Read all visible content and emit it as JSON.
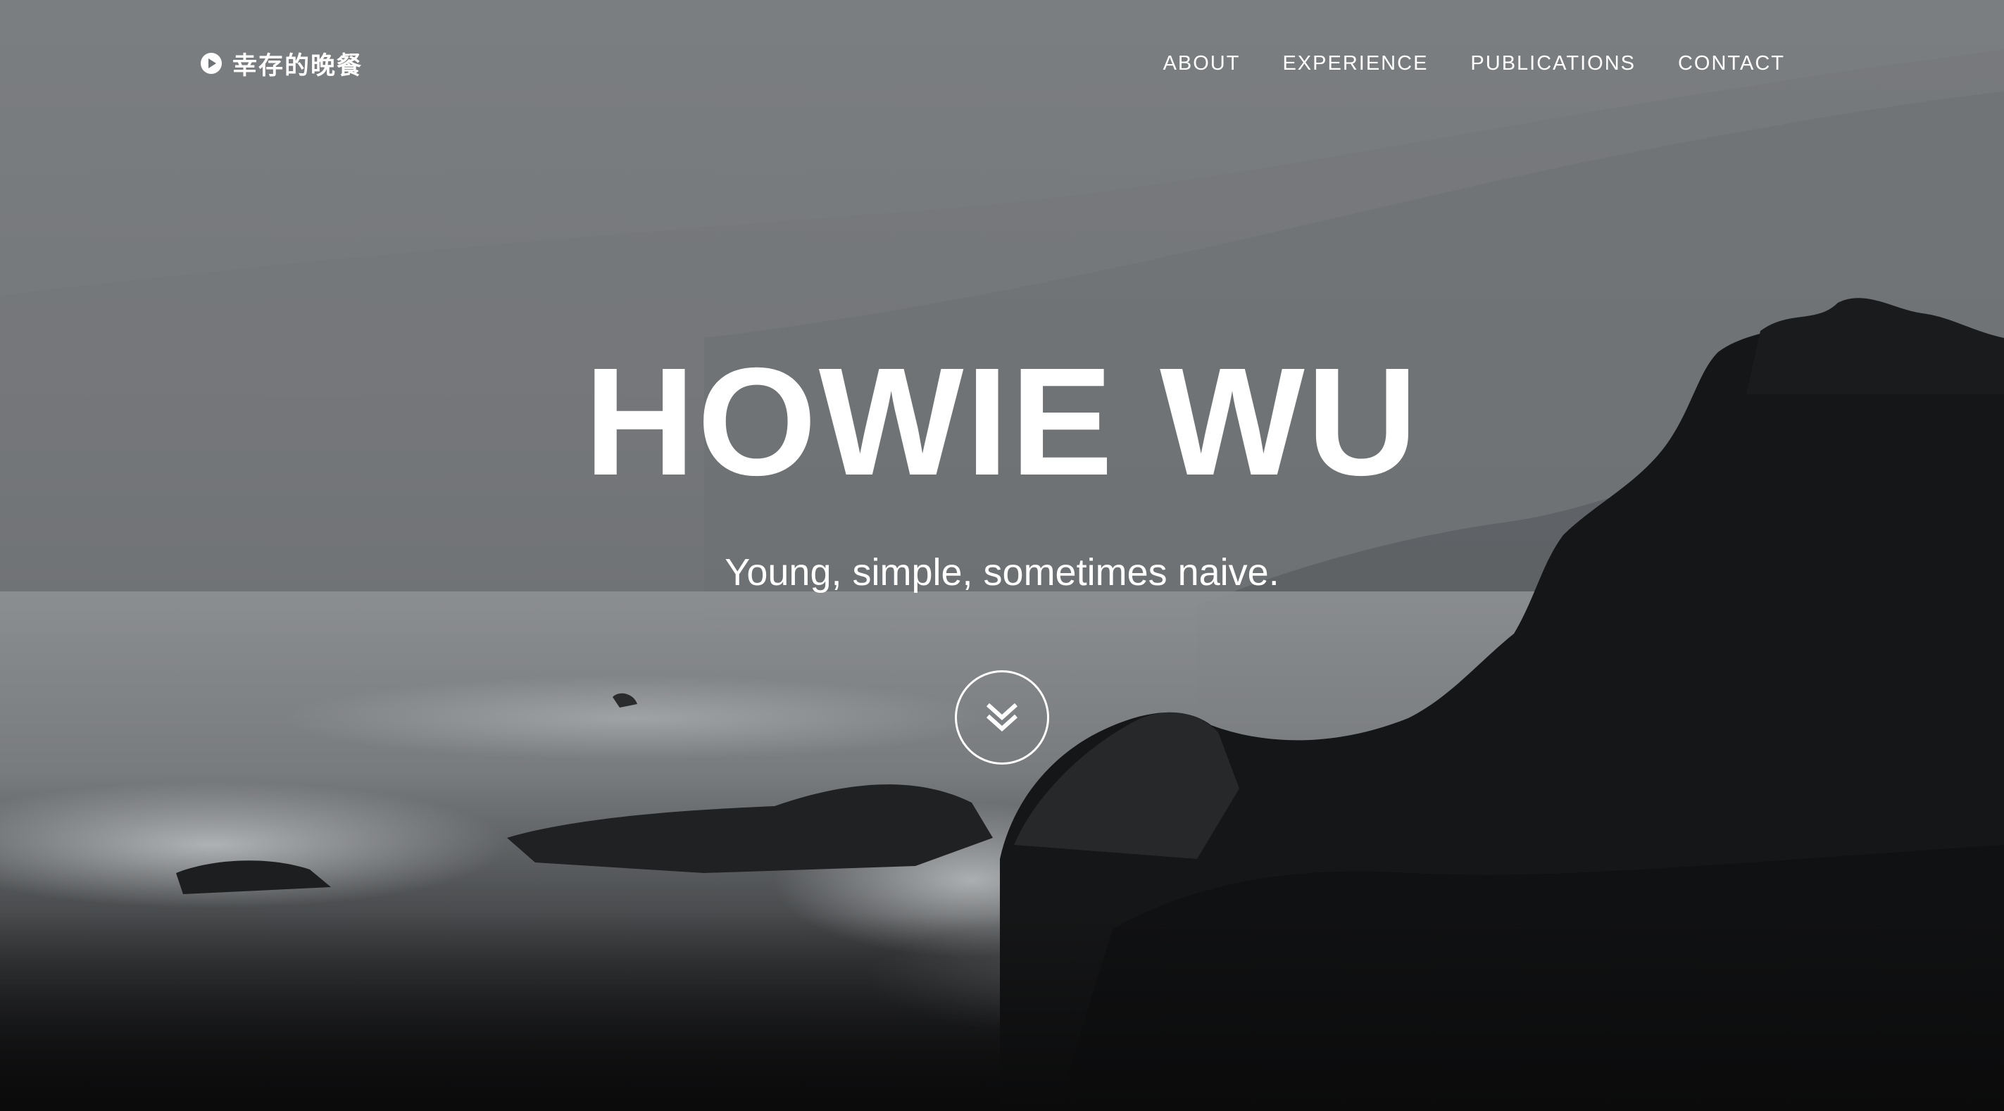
{
  "navbar": {
    "brand": {
      "icon": "play-circle-icon",
      "label": "幸存的晚餐"
    },
    "links": [
      {
        "label": "ABOUT"
      },
      {
        "label": "EXPERIENCE"
      },
      {
        "label": "PUBLICATIONS"
      },
      {
        "label": "CONTACT"
      }
    ]
  },
  "hero": {
    "title": "HOWIE WU",
    "subtitle": "Young, simple, sometimes naive.",
    "scroll_icon": "double-chevron-down-icon",
    "background": "grayscale-sea-rocks-photo"
  },
  "colors": {
    "text": "#ffffff",
    "sky": "#7b7e80",
    "rocks": "#111213"
  }
}
